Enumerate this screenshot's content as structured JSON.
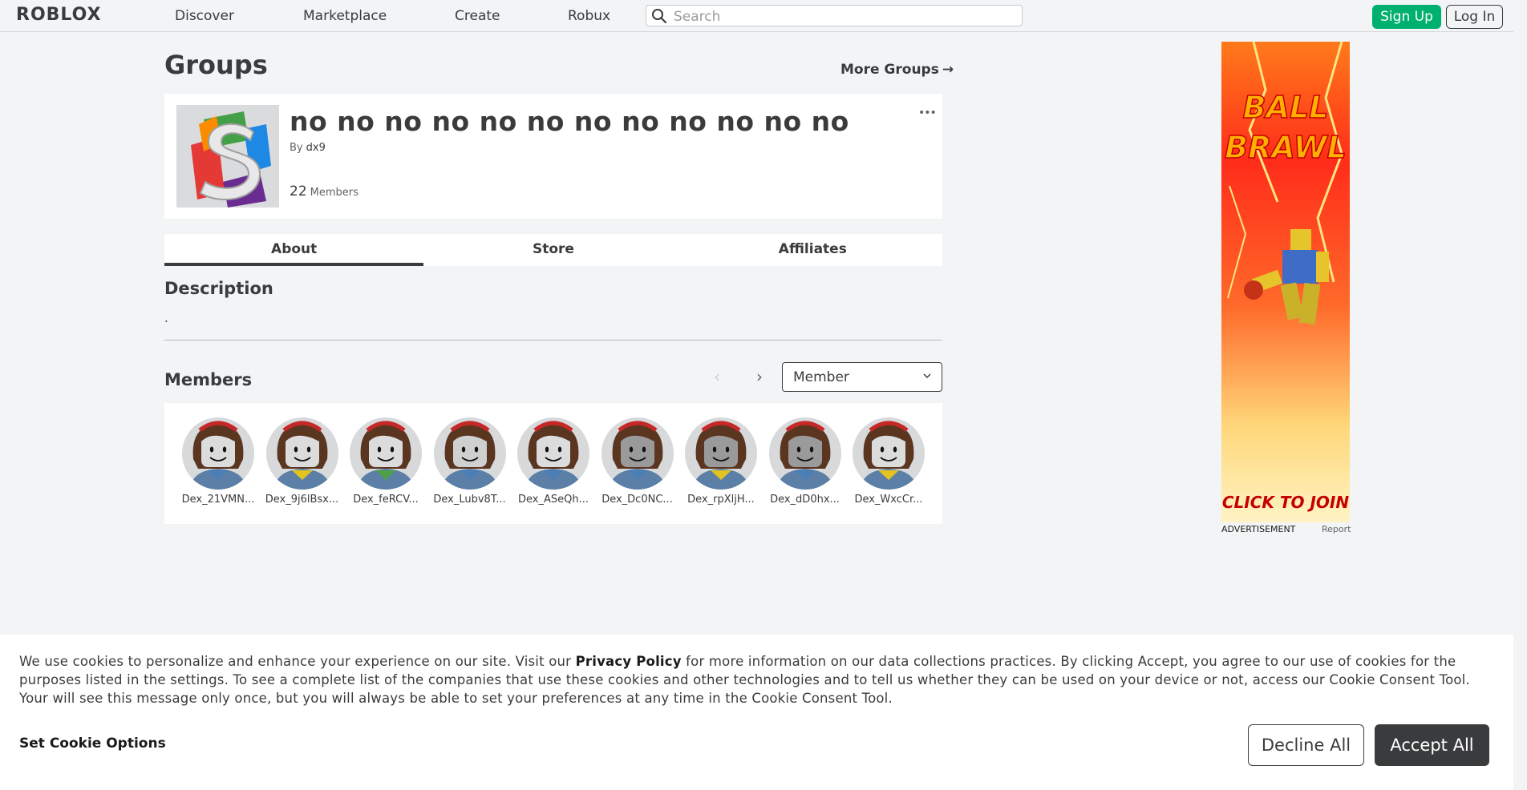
{
  "header": {
    "logo": "ROBLOX",
    "nav": [
      "Discover",
      "Marketplace",
      "Create",
      "Robux"
    ],
    "search_placeholder": "Search",
    "signup_label": "Sign Up",
    "login_label": "Log In"
  },
  "page": {
    "title": "Groups",
    "more_groups_label": "More Groups",
    "more_groups_arrow": "→"
  },
  "group": {
    "name": "no no no no no no no no no no no no",
    "by_label": "By",
    "owner": "dx9",
    "member_count": "22",
    "members_label": "Members",
    "menu_glyph": "•••"
  },
  "tabs": [
    "About",
    "Store",
    "Affiliates"
  ],
  "active_tab": "About",
  "description": {
    "title": "Description",
    "text": "."
  },
  "members_section": {
    "title": "Members",
    "role_selected": "Member",
    "prev_glyph": "‹",
    "next_glyph": "›",
    "members": [
      {
        "name": "Dex_21VMN...",
        "tone": "#dcdcdc",
        "accent": "#4a7fb5"
      },
      {
        "name": "Dex_9j6lBsx...",
        "tone": "#dcdcdc",
        "accent": "#e3c320"
      },
      {
        "name": "Dex_feRCV...",
        "tone": "#dcdcdc",
        "accent": "#4fa04a"
      },
      {
        "name": "Dex_Lubv8T...",
        "tone": "#d0d0d0",
        "accent": "#4a7fb5"
      },
      {
        "name": "Dex_ASeQh...",
        "tone": "#dcdcdc",
        "accent": "#4a7fb5"
      },
      {
        "name": "Dex_Dc0NC...",
        "tone": "#9a9a9a",
        "accent": "#4a7fb5"
      },
      {
        "name": "Dex_rpXljH...",
        "tone": "#9a9a9a",
        "accent": "#e3c320"
      },
      {
        "name": "Dex_dD0hx...",
        "tone": "#9a9a9a",
        "accent": "#4a7fb5"
      },
      {
        "name": "Dex_WxcCr...",
        "tone": "#dcdcdc",
        "accent": "#e3c320"
      }
    ]
  },
  "ad": {
    "headline_1": "BALL",
    "headline_2": "BRAWL",
    "cta": "CLICK TO JOIN",
    "label": "ADVERTISEMENT",
    "report": "Report"
  },
  "cookie_banner": {
    "text_before": "We use cookies to personalize and enhance your experience on our site. Visit our ",
    "privacy_link": "Privacy Policy",
    "text_after": " for more information on our data collections practices. By clicking Accept, you agree to our use of cookies for the purposes listed in the settings. To see a complete list of the companies that use these cookies and other technologies and to tell us whether they can be used on your device or not, access our Cookie Consent Tool. Your will see this message only once, but you will always be able to set your preferences at any time in the Cookie Consent Tool.",
    "set_options": "Set Cookie Options",
    "decline": "Decline All",
    "accept": "Accept All"
  },
  "colors": {
    "brand_green": "#00b06f",
    "text_dark": "#393b3d",
    "background": "#f2f4f5"
  }
}
